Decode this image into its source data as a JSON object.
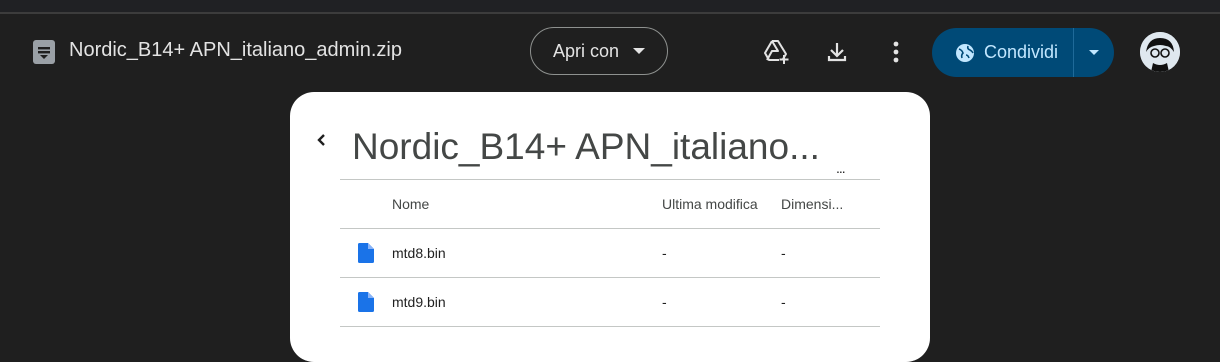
{
  "header": {
    "file_name": "Nordic_B14+ APN_italiano_admin.zip",
    "open_with_label": "Apri con",
    "share_label": "Condividi",
    "icons": [
      "zip-file-icon",
      "add-to-drive-icon",
      "download-icon",
      "more-vert-icon",
      "globe-icon",
      "avatar"
    ],
    "colors": {
      "background": "#1f1f1f",
      "share_bg": "#004a77",
      "share_text": "#c2e7ff",
      "file_blue": "#1a73e8"
    }
  },
  "panel": {
    "title": "Nordic_B14+ APN_italiano...",
    "more_label": "...",
    "columns": {
      "name": "Nome",
      "modified": "Ultima modifica",
      "size": "Dimensi..."
    },
    "rows": [
      {
        "name": "mtd8.bin",
        "modified": "-",
        "size": "-"
      },
      {
        "name": "mtd9.bin",
        "modified": "-",
        "size": "-"
      }
    ]
  }
}
